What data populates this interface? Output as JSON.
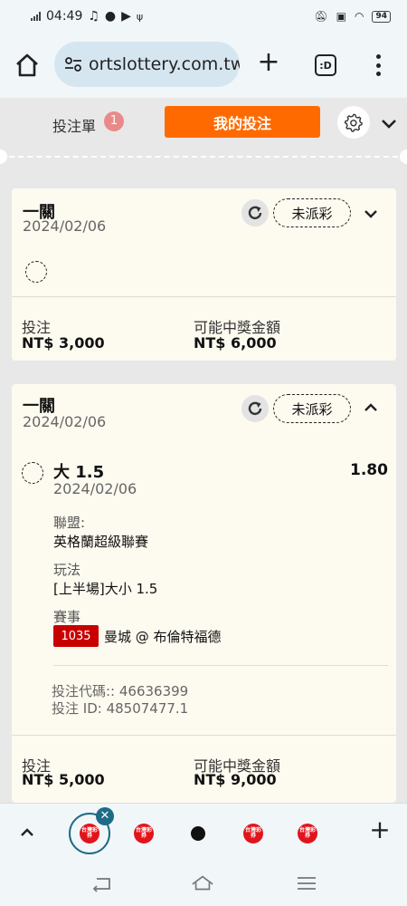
{
  "status_bar": {
    "time": "04:49",
    "battery": "94"
  },
  "browser": {
    "url": "ortslottery.com.tw",
    "tab_switcher_label": ":D"
  },
  "betslip": {
    "tab_label": "投注單",
    "count": "1",
    "my_bets_label": "我的投注"
  },
  "bets": [
    {
      "title": "一關",
      "date": "2024/02/06",
      "status": "未派彩",
      "stake_label": "投注",
      "stake": "NT$ 3,000",
      "payout_label": "可能中獎金額",
      "payout": "NT$ 6,000"
    },
    {
      "title": "一關",
      "date": "2024/02/06",
      "status": "未派彩",
      "selection": {
        "name": "大 1.5",
        "odds": "1.80",
        "date": "2024/02/06",
        "league_label": "聯盟:",
        "league": "英格蘭超級聯賽",
        "market_label": "玩法",
        "market": "[上半場]大小 1.5",
        "event_label": "賽事",
        "event_id": "1035",
        "event": "曼城 @ 布倫特福德"
      },
      "bet_code": "投注代碼:: 46636399",
      "bet_id": "投注 ID: 48507477.1",
      "stake_label": "投注",
      "stake": "NT$ 5,000",
      "payout_label": "可能中獎金額",
      "payout": "NT$ 9,000"
    }
  ],
  "tab_strip": {
    "favicon_text": "台灣彩券"
  },
  "colors": {
    "accent": "#ff6a00",
    "badge": "#e88a8a",
    "event_tag": "#c80000",
    "card_bg": "#fdfaf0",
    "active_tab": "#1e6b86"
  }
}
